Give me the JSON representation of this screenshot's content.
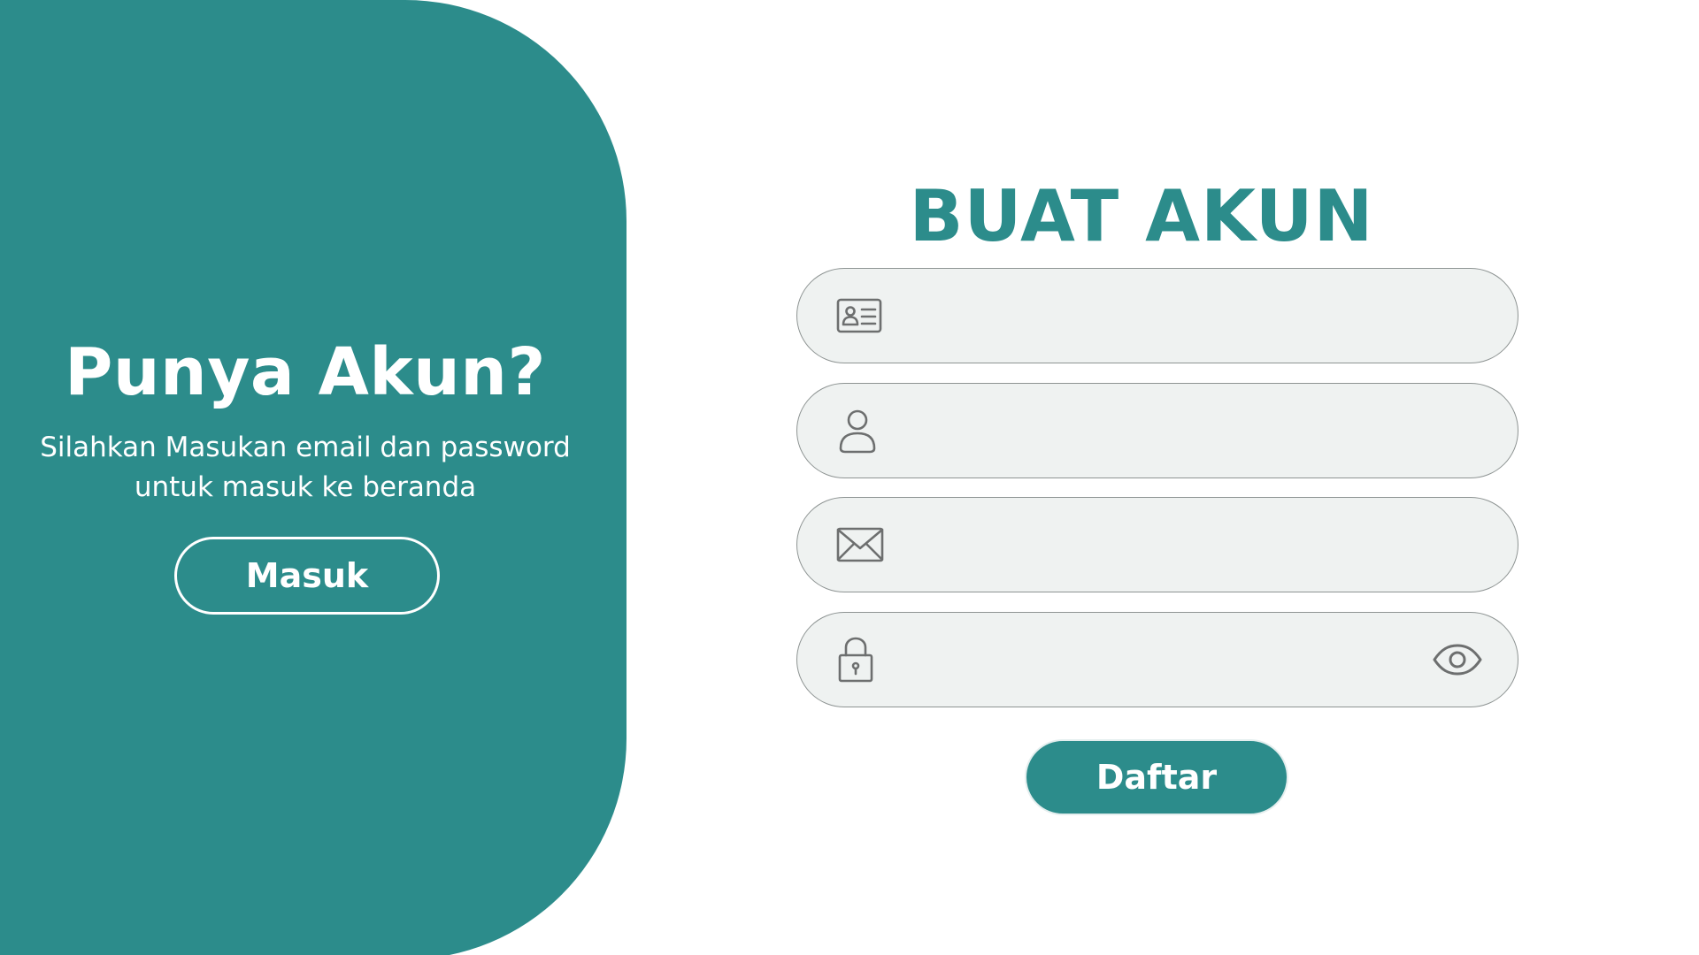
{
  "colors": {
    "primary": "#2c8c8b",
    "field_bg": "#eff2f1",
    "field_border": "#8e9493",
    "icon": "#6d6f6f",
    "white": "#ffffff"
  },
  "left_panel": {
    "title": "Punya Akun?",
    "description_line1": "Silahkan Masukan email dan password",
    "description_line2": "untuk masuk ke beranda",
    "login_button_label": "Masuk"
  },
  "register_form": {
    "title": "BUAT AKUN",
    "fields": [
      {
        "name": "full-name",
        "icon": "id-card-icon",
        "value": "",
        "placeholder": ""
      },
      {
        "name": "username",
        "icon": "user-icon",
        "value": "",
        "placeholder": ""
      },
      {
        "name": "email",
        "icon": "envelope-icon",
        "value": "",
        "placeholder": ""
      },
      {
        "name": "password",
        "icon": "lock-icon",
        "value": "",
        "placeholder": "",
        "toggle_icon": "eye-icon"
      }
    ],
    "submit_label": "Daftar"
  }
}
